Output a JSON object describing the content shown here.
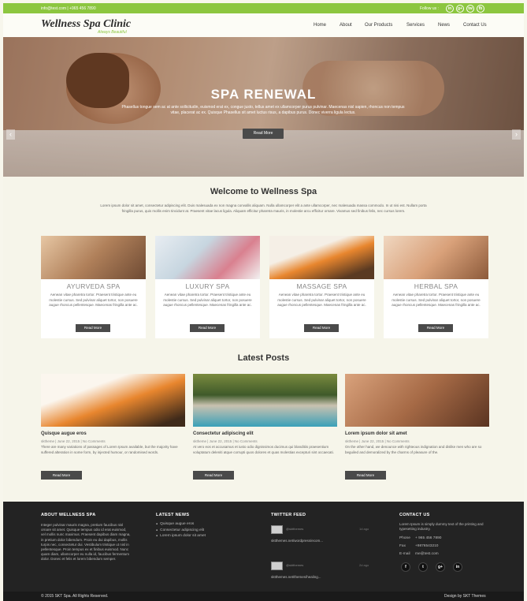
{
  "topbar": {
    "contact": "info@test.com  |  +965 456 7890",
    "follow_label": "Follow us :",
    "social_icons": [
      "in",
      "g+",
      "tw",
      "fb"
    ]
  },
  "header": {
    "logo": "Wellness Spa Clinic",
    "tagline": "Always Beautiful",
    "nav": [
      "Home",
      "About",
      "Our Products",
      "Services",
      "News",
      "Contact Us"
    ]
  },
  "hero": {
    "title": "SPA RENEWAL",
    "text": "Phasellus tongue sem ac at ante sollicitudin, euismod erat ex, congue justo, tellus amet ex ullamcorper purus pulvinar. Maecenas nisl sapien, rhoncus non tempus vitae, placerat ac ex. Quisque Phasellus sit amet luctus risus, a dapibus purus. Donec viverra ligula lectus.",
    "button": "Read More",
    "prev_icon": "‹",
    "next_icon": "›"
  },
  "welcome": {
    "title": "Welcome to Wellness Spa",
    "text": "Lorem ipsum dolor sit amet, consectetur adipiscing elit. Duis malesuada ex non magna convallis aliquam. Nulla ullamcorper elit a ante ullamcorper, nec malesuada massa commodo. In ut nisi est. Nullam porta fringilla purus, quis mollis enim tincidunt at. Praesent vitae lacus ligula. Aliquam efficitur pharetra mauris, in molestie arcu efficitur ornare. Vivamus sed finibus felis, nec cursus lorem."
  },
  "services": [
    {
      "name": "AYURVEDA SPA",
      "desc": "Aenean vitae pharetra tortor. Praesent tristique ante eu molestie cursus. Sed pulvinar aliquet tortor, non posuere augue rhoncus pellentesque. Maecenas fringilla ante ac.",
      "button": "Read More"
    },
    {
      "name": "LUXURY SPA",
      "desc": "Aenean vitae pharetra tortor. Praesent tristique ante eu molestie cursus. Sed pulvinar aliquet tortor, non posuere augue rhoncus pellentesque. Maecenas fringilla ante ac.",
      "button": "Read More"
    },
    {
      "name": "MASSAGE SPA",
      "desc": "Aenean vitae pharetra tortor. Praesent tristique ante eu molestie cursus. Sed pulvinar aliquet tortor, non posuere augue rhoncus pellentesque. Maecenas fringilla ante ac.",
      "button": "Read More"
    },
    {
      "name": "HERBAL SPA",
      "desc": "Aenean vitae pharetra tortor. Praesent tristique ante eu molestie cursus. Sed pulvinar aliquet tortor, non posuere augue rhoncus pellentesque. Maecenas fringilla ante ac.",
      "button": "Read More"
    }
  ],
  "posts": {
    "title": "Latest Posts",
    "items": [
      {
        "title": "Quisque augue eros",
        "meta": "sktheme | June 22, 2015 | No Comments",
        "excerpt": "There are many variations of passages of Lorem Ipsum available, but the majority have suffered alteration in some form, by injected humour, or randomised words.",
        "button": "Read More"
      },
      {
        "title": "Consectetur adipiscing elit",
        "meta": "sktheme | June 22, 2015 | No Comments",
        "excerpt": "At vero eos et accusamus et iusto odio dignissimos ducimus qui blanditiis praesentium voluptatum deleniti atque corrupti quos dolores et quas molestias excepturi sint occaecati.",
        "button": "Read More"
      },
      {
        "title": "Lorem ipsum dolor sit amet",
        "meta": "sktheme | June 22, 2015 | No Comments",
        "excerpt": "On the other hand, we denounce with righteous indignation and dislike men who are so beguiled and demoralized by the charms of pleasure of the.",
        "button": "Read More"
      }
    ]
  },
  "footer": {
    "about": {
      "heading": "ABOUT WELLNESS SPA",
      "text": "Integer pulvinar mauris magna, pretium faucibus nisl ornare sit amet. Quisque tempus odio id erat euismod, vel mollis nunc maximus. Praesent dapibus diam magna, in pretium dolor bibendum. Proin eu dui dapibus, mollis turpis nec, consectetur dui. Vestibulum tristique ut nisl in pellentesque. Proin tempus ex et finibus euismod. Nunc quam diam, ullamcorper eu nulla id, faucibus fermentum dolor. Donec et felis et lorem bibendum semper."
    },
    "news": {
      "heading": "LATEST NEWS",
      "items": [
        "Quisque augue eros",
        "Consectetur adipiscing elit",
        "Lorem ipsum dolor sit amet"
      ]
    },
    "twitter": {
      "heading": "TWITTER FEED",
      "tweets": [
        {
          "handle": "@sktthemes",
          "time": "1d ago",
          "link": "sktthemes.net/wordpress/ecom..."
        },
        {
          "handle": "@sktthemes",
          "time": "2d ago",
          "link": "sktthemes.net/themes/healing..."
        }
      ]
    },
    "contact": {
      "heading": "CONTACT US",
      "text": "Lorem Ipsum is simply dummy text of the printing and typesetting industry.",
      "phone_label": "Phone",
      "phone": "+ 965 456 7890",
      "fax_label": "Fax",
      "fax": "+9876543210",
      "email_label": "E-mail",
      "email": "me@test.com",
      "social_icons": [
        "f",
        "t",
        "g+",
        "in"
      ]
    }
  },
  "bottombar": {
    "copyright": "© 2015 SKT Spa. All Rights Reserved.",
    "credit": "Design by SKT Themes"
  },
  "colors": {
    "accent": "#8cc63f",
    "footer_bg": "#232323",
    "button_bg": "#4a4a4a",
    "page_bg": "#f6f5ea"
  }
}
